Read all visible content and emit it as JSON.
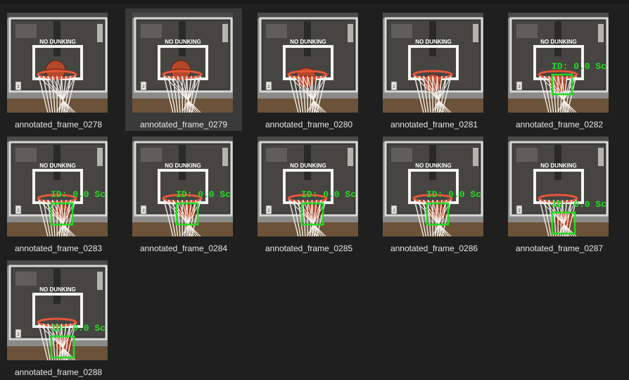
{
  "explorer": {
    "files": [
      {
        "name": "annotated_frame_0278",
        "selected": false,
        "ball": "above",
        "detected": false
      },
      {
        "name": "annotated_frame_0279",
        "selected": true,
        "ball": "above",
        "detected": false
      },
      {
        "name": "annotated_frame_0280",
        "selected": false,
        "ball": "rim",
        "detected": false
      },
      {
        "name": "annotated_frame_0281",
        "selected": false,
        "ball": "in",
        "detected": false
      },
      {
        "name": "annotated_frame_0282",
        "selected": false,
        "ball": "in",
        "detected": true
      },
      {
        "name": "annotated_frame_0283",
        "selected": false,
        "ball": "net",
        "detected": true
      },
      {
        "name": "annotated_frame_0284",
        "selected": false,
        "ball": "net",
        "detected": true
      },
      {
        "name": "annotated_frame_0285",
        "selected": false,
        "ball": "net",
        "detected": true
      },
      {
        "name": "annotated_frame_0286",
        "selected": false,
        "ball": "net",
        "detected": true
      },
      {
        "name": "annotated_frame_0287",
        "selected": false,
        "ball": "low",
        "detected": true
      },
      {
        "name": "annotated_frame_0288",
        "selected": false,
        "ball": "low",
        "detected": true
      }
    ],
    "backboard_text": "NO DUNKING",
    "tag_text": "2",
    "detection_label": "ID: 0.0 Sc",
    "colors": {
      "background": "#1f1f1f",
      "selected": "#3a3a3a",
      "label_text": "#e8e8e8",
      "box_green": "#22dd22",
      "wall": "#8a8a88",
      "floor": "#6b5238"
    }
  }
}
